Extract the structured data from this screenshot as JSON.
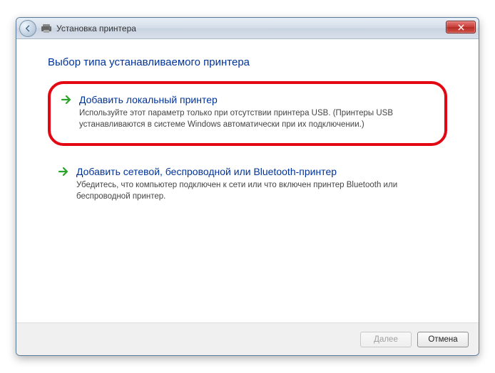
{
  "window": {
    "title": "Установка принтера"
  },
  "heading": "Выбор типа устанавливаемого принтера",
  "options": [
    {
      "title": "Добавить локальный принтер",
      "description": "Используйте этот параметр только при отсутствии принтера USB. (Принтеры USB устанавливаются в системе Windows автоматически при их подключении.)"
    },
    {
      "title": "Добавить сетевой, беспроводной или Bluetooth-принтер",
      "description": "Убедитесь, что компьютер подключен к сети или что включен принтер Bluetooth или беспроводной принтер."
    }
  ],
  "footer": {
    "next_label": "Далее",
    "cancel_label": "Отмена"
  }
}
